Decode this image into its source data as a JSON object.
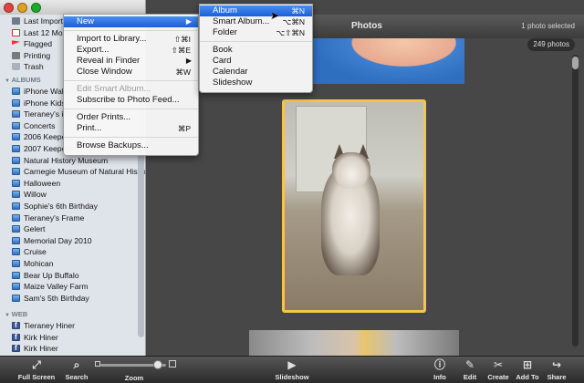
{
  "sidebar": {
    "library": [
      {
        "label": "Last Import",
        "icon": "import-icon"
      },
      {
        "label": "Last 12 Months",
        "icon": "calendar-icon"
      },
      {
        "label": "Flagged",
        "icon": "flag-icon"
      },
      {
        "label": "Printing",
        "icon": "printer-icon"
      },
      {
        "label": "Trash",
        "icon": "trash-icon"
      }
    ],
    "albums_header": "ALBUMS",
    "albums": [
      "iPhone Wallpapers",
      "iPhone Kids",
      "Tieraney's iPhone",
      "Concerts",
      "2006 Keepers",
      "2007 Keepers",
      "Natural History Museum",
      "Carnegie Museum of Natural History",
      "Halloween",
      "Willow",
      "Sophie's 6th Birthday",
      "Tieraney's Frame",
      "Gelert",
      "Memorial Day 2010",
      "Cruise",
      "Mohican",
      "Bear Up Buffalo",
      "Maize Valley Farm",
      "Sam's 5th Birthday"
    ],
    "web_header": "WEB",
    "web": [
      "Tieraney Hiner",
      "Kirk Hiner",
      "Kirk Hiner"
    ]
  },
  "main": {
    "title": "Photos",
    "selected_status": "1 photo selected",
    "photo_count": "249 photos"
  },
  "file_menu": {
    "items": [
      {
        "label": "New",
        "shortcut": "",
        "submenu": true,
        "highlighted": true
      },
      {
        "sep": true
      },
      {
        "label": "Import to Library...",
        "shortcut": "⇧⌘I"
      },
      {
        "label": "Export...",
        "shortcut": "⇧⌘E"
      },
      {
        "label": "Reveal in Finder",
        "shortcut": "",
        "submenu": true
      },
      {
        "label": "Close Window",
        "shortcut": "⌘W"
      },
      {
        "sep": true
      },
      {
        "label": "Edit Smart Album...",
        "shortcut": "",
        "disabled": true
      },
      {
        "label": "Subscribe to Photo Feed...",
        "shortcut": ""
      },
      {
        "sep": true
      },
      {
        "label": "Order Prints...",
        "shortcut": ""
      },
      {
        "label": "Print...",
        "shortcut": "⌘P"
      },
      {
        "sep": true
      },
      {
        "label": "Browse Backups...",
        "shortcut": ""
      }
    ]
  },
  "new_menu": {
    "items": [
      {
        "label": "Album",
        "shortcut": "⌘N",
        "highlighted": true
      },
      {
        "label": "Smart Album...",
        "shortcut": "⌥⌘N"
      },
      {
        "label": "Folder",
        "shortcut": "⌥⇧⌘N"
      },
      {
        "sep": true
      },
      {
        "label": "Book",
        "shortcut": ""
      },
      {
        "label": "Card",
        "shortcut": ""
      },
      {
        "label": "Calendar",
        "shortcut": ""
      },
      {
        "label": "Slideshow",
        "shortcut": ""
      }
    ]
  },
  "toolbar": {
    "full_screen": "Full Screen",
    "search": "Search",
    "zoom": "Zoom",
    "slideshow": "Slideshow",
    "info": "Info",
    "edit": "Edit",
    "create": "Create",
    "add_to": "Add To",
    "share": "Share"
  },
  "colors": {
    "accent": "#1a5fd6",
    "selection_border": "#f1c64a"
  }
}
